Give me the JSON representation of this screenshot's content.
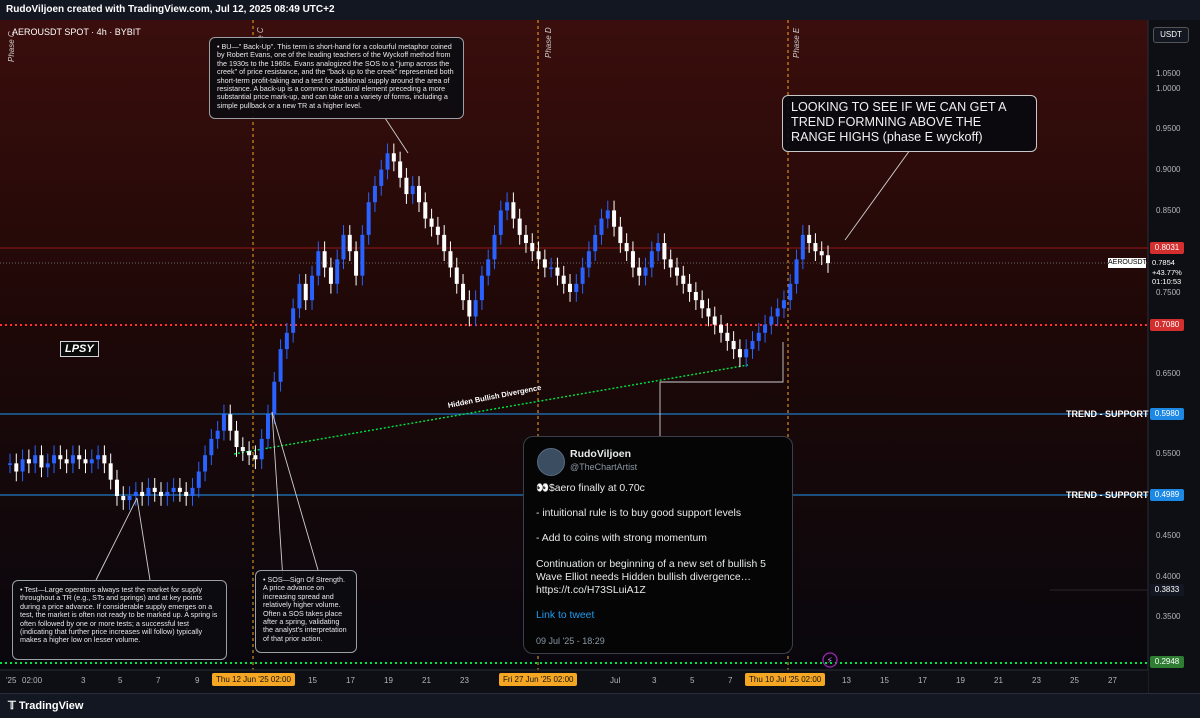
{
  "header": {
    "title": "RudoViljoen created with TradingView.com, Jul 12, 2025 08:49 UTC+2"
  },
  "symbol": "AEROUSDT SPOT · 4h · BYBIT",
  "currency": "USDT",
  "footer": {
    "brand": "TradingView"
  },
  "colors": {
    "bull": "#2962ff",
    "bear": "#ffffff",
    "support": "#2196f3",
    "resistance_dotted": "#ff3333",
    "divergence": "#00e640",
    "phase_lines": "#f5a623",
    "bg_top": "#3a0e0c",
    "bg_bottom": "#0a0a12"
  },
  "notes": {
    "bu": "• BU—\" Back-Up\". This term is short-hand for a colourful metaphor coined by Robert Evans, one of the leading teachers of the Wyckoff method from the 1930s to the 1960s. Evans analogized the SOS to a \"jump across the creek\" of price resistance, and the \"back up to the creek\" represented both short-term profit-taking and a test for additional supply around the area of resistance. A back-up is a common structural element preceding a more substantial price mark-up, and can take on a variety of forms, including a simple pullback or a new TR at a higher level.",
    "test": "• Test—Large operators always test the market for supply throughout a TR (e.g., STs and springs) and at key points during a price advance. If considerable supply emerges on a test, the market is often not ready to be marked up. A spring is often followed by one or more tests; a successful test (indicating that further price increases will follow) typically makes a higher low on lesser volume.",
    "sos": "• SOS—Sign Of Strength. A price advance on increasing spread and relatively higher volume. Often a SOS takes place after a spring, validating the analyst's interpretation of that prior action."
  },
  "callout": "LOOKING TO SEE IF WE CAN GET A TREND FORMNING ABOVE THE RANGE HIGHS (phase E wyckoff)",
  "tweet": {
    "name": "RudoViljoen",
    "handle": "@TheChartArtist",
    "line1": "👀$aero finally at 0.70c",
    "line2": "- intuitional rule is to buy good support levels",
    "line3": "- Add to coins with strong momentum",
    "line4": "Continuation or beginning of a new set of bullish 5 Wave Elliot needs Hidden bullish divergence… https://t.co/H73SLuiA1Z",
    "link": "Link to tweet",
    "date": "09 Jul '25 - 18:29"
  },
  "labels": {
    "lpsy": "LPSY",
    "trend1": "TREND - SUPPORT",
    "trend2": "TREND - SUPPORT",
    "divergence": "Hidden Bullish Divergence",
    "phase_c": "Phase C",
    "phase_d": "Phase D",
    "phase_e": "Phase E",
    "current_symbol": "AEROUSDT"
  },
  "price_axis": {
    "ticks": [
      "1.0500",
      "1.0000",
      "0.9500",
      "0.9000",
      "0.8500",
      "0.7500",
      "0.6500",
      "0.5500",
      "0.4500",
      "0.4000",
      "0.3500"
    ],
    "tags": [
      {
        "label": "0.8031",
        "color": "#d32f2f"
      },
      {
        "label": "0.7080",
        "color": "#d32f2f"
      },
      {
        "label": "0.5980",
        "color": "#1e88e5"
      },
      {
        "label": "0.4989",
        "color": "#1e88e5"
      },
      {
        "label": "0.3833",
        "color": "#131722"
      },
      {
        "label": "0.2948",
        "color": "#2e7d32"
      }
    ],
    "current": {
      "price": "0.7854",
      "change": "+43.77%",
      "countdown": "01:10:53"
    }
  },
  "time_axis": {
    "ticks": [
      "'25",
      "02:00",
      "3",
      "5",
      "7",
      "9",
      "15",
      "17",
      "19",
      "21",
      "23",
      "Jul",
      "3",
      "5",
      "7",
      "13",
      "15",
      "17",
      "19",
      "21",
      "23",
      "25",
      "27"
    ],
    "highlighted": [
      "Thu 12 Jun '25   02:00",
      "Fri 27 Jun '25   02:00",
      "Thu 10 Jul '25   02:00"
    ]
  },
  "chart_data": {
    "type": "candlestick",
    "timeframe": "4h",
    "ylim": [
      0.28,
      1.08
    ],
    "x": [
      "2025-06-01",
      "2025-07-11"
    ],
    "closes": [
      0.54,
      0.53,
      0.545,
      0.54,
      0.55,
      0.535,
      0.54,
      0.55,
      0.545,
      0.54,
      0.55,
      0.545,
      0.54,
      0.545,
      0.55,
      0.54,
      0.52,
      0.5,
      0.495,
      0.5,
      0.505,
      0.5,
      0.51,
      0.505,
      0.5,
      0.505,
      0.51,
      0.505,
      0.5,
      0.51,
      0.53,
      0.55,
      0.57,
      0.58,
      0.6,
      0.58,
      0.56,
      0.555,
      0.55,
      0.545,
      0.57,
      0.6,
      0.64,
      0.68,
      0.7,
      0.73,
      0.76,
      0.74,
      0.77,
      0.8,
      0.78,
      0.76,
      0.79,
      0.82,
      0.8,
      0.77,
      0.82,
      0.86,
      0.88,
      0.9,
      0.92,
      0.91,
      0.89,
      0.87,
      0.88,
      0.86,
      0.84,
      0.83,
      0.82,
      0.8,
      0.78,
      0.76,
      0.74,
      0.72,
      0.74,
      0.77,
      0.79,
      0.82,
      0.85,
      0.86,
      0.84,
      0.82,
      0.81,
      0.8,
      0.79,
      0.78,
      0.78,
      0.77,
      0.76,
      0.75,
      0.76,
      0.78,
      0.8,
      0.82,
      0.84,
      0.85,
      0.83,
      0.81,
      0.8,
      0.78,
      0.77,
      0.78,
      0.8,
      0.81,
      0.79,
      0.78,
      0.77,
      0.76,
      0.75,
      0.74,
      0.73,
      0.72,
      0.71,
      0.7,
      0.69,
      0.68,
      0.67,
      0.68,
      0.69,
      0.7,
      0.71,
      0.72,
      0.73,
      0.74,
      0.76,
      0.79,
      0.82,
      0.81,
      0.8,
      0.795,
      0.7854
    ],
    "horizontal_levels": [
      {
        "name": "TREND - SUPPORT",
        "value": 0.598
      },
      {
        "name": "TREND - SUPPORT",
        "value": 0.4989
      },
      {
        "value": 0.803
      },
      {
        "value": 0.708
      },
      {
        "value": 0.2948
      }
    ]
  }
}
